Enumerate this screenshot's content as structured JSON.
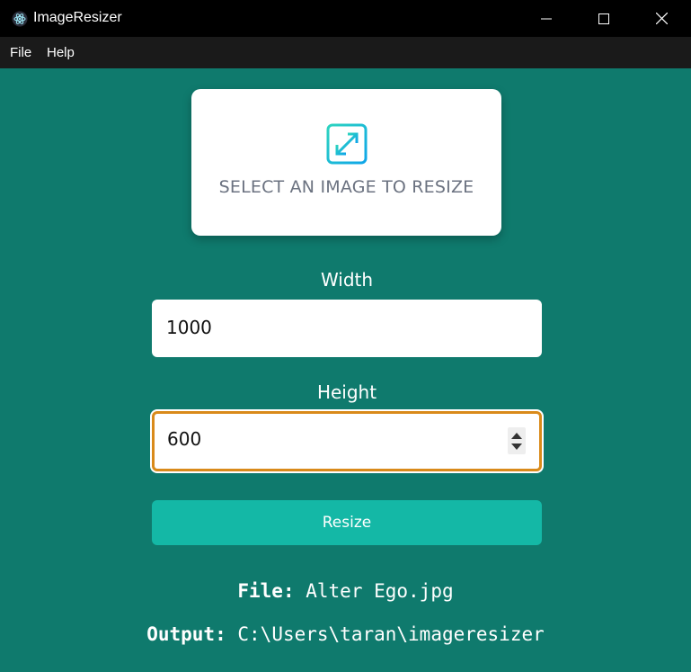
{
  "window": {
    "title": "ImageResizer",
    "icon": "electron-icon",
    "controls": [
      "minimize-icon",
      "maximize-icon",
      "close-icon"
    ]
  },
  "menu": {
    "items": [
      "File",
      "Help"
    ]
  },
  "upload": {
    "icon": "resize-arrows-icon",
    "label": "SELECT AN IMAGE TO RESIZE"
  },
  "form": {
    "width_label": "Width",
    "width_value": "1000",
    "height_label": "Height",
    "height_value": "600",
    "submit_label": "Resize"
  },
  "info": {
    "file_label": "File:",
    "file_value": "Alter Ego.jpg",
    "output_label": "Output:",
    "output_value": "C:\\Users\\taran\\imageresizer"
  },
  "colors": {
    "background": "#0f7a6d",
    "button": "#14b8a6",
    "focus_border": "#d98a1a"
  }
}
